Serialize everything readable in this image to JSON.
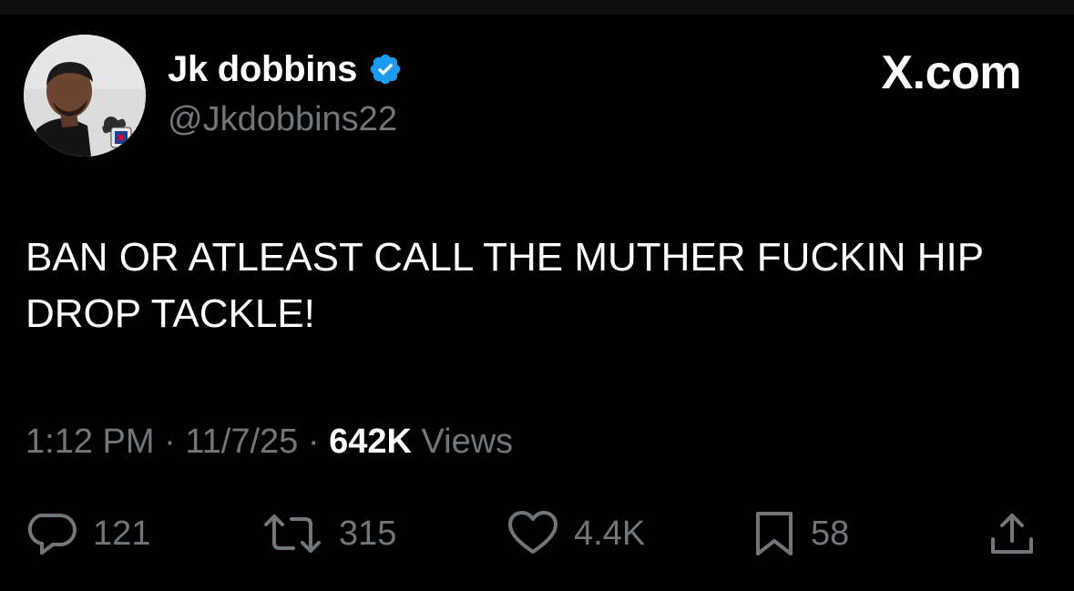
{
  "author": {
    "display_name": "Jk dobbins",
    "handle": "@Jkdobbins22",
    "verified": true
  },
  "site_logo": "X.com",
  "tweet": {
    "text": "BAN OR ATLEAST CALL THE MUTHER FUCKIN HIP DROP TACKLE!"
  },
  "meta": {
    "time": "1:12 PM",
    "separator": "·",
    "date": "11/7/25",
    "views_count": "642K",
    "views_label": "Views"
  },
  "actions": {
    "replies": "121",
    "reposts": "315",
    "likes": "4.4K",
    "bookmarks": "58"
  },
  "colors": {
    "background": "#000000",
    "primary_text": "#ffffff",
    "secondary_text": "#71767b",
    "verified_badge": "#1d9bf0"
  }
}
